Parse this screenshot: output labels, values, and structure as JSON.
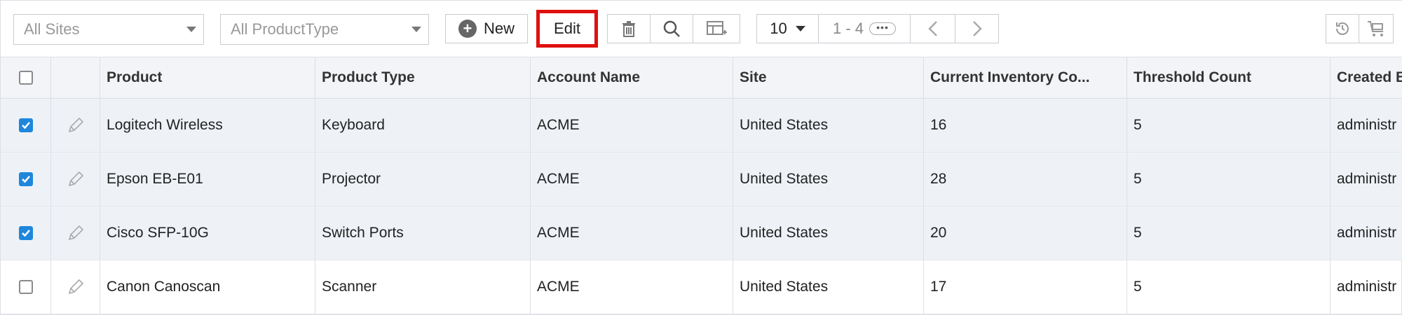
{
  "toolbar": {
    "site_filter": "All Sites",
    "type_filter": "All ProductType",
    "new_label": "New",
    "edit_label": "Edit",
    "page_size": "10",
    "range": "1 - 4",
    "more": "•••",
    "icons": [
      "trash-icon",
      "search-icon",
      "add-column-icon",
      "chevron-left-icon",
      "chevron-right-icon",
      "history-icon",
      "cart-icon"
    ]
  },
  "columns": [
    "Product",
    "Product Type",
    "Account Name",
    "Site",
    "Current Inventory Co...",
    "Threshold Count",
    "Created B"
  ],
  "rows": [
    {
      "checked": true,
      "cells": [
        "Logitech Wireless",
        "Keyboard",
        "ACME",
        "United States",
        "16",
        "5",
        "administr"
      ]
    },
    {
      "checked": true,
      "cells": [
        "Epson EB-E01",
        "Projector",
        "ACME",
        "United States",
        "28",
        "5",
        "administr"
      ]
    },
    {
      "checked": true,
      "cells": [
        "Cisco SFP-10G",
        "Switch Ports",
        "ACME",
        "United States",
        "20",
        "5",
        "administr"
      ]
    },
    {
      "checked": false,
      "cells": [
        "Canon Canoscan",
        "Scanner",
        "ACME",
        "United States",
        "17",
        "5",
        "administr"
      ]
    }
  ],
  "colors": {
    "accent": "#1f87db",
    "highlight": "#e01010",
    "selected_row": "#eef2f7"
  }
}
